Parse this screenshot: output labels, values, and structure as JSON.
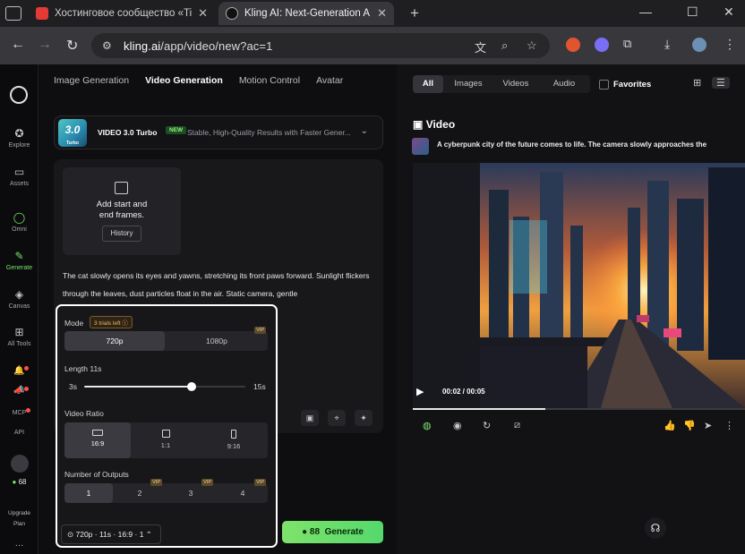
{
  "browser": {
    "tabs": [
      {
        "title": "Хостинговое сообщество «Tim",
        "close": "✕"
      },
      {
        "title": "Kling AI: Next-Generation AI Cr",
        "close": "✕"
      }
    ],
    "new_tab": "+",
    "window_controls": {
      "minimize": "—",
      "maximize": "☐",
      "close": "✕"
    },
    "url_domain": "kling.ai",
    "url_path": "/app/video/new?ac=1",
    "nav": {
      "back": "←",
      "forward": "→",
      "reload": "↻"
    }
  },
  "rail": {
    "items": [
      {
        "label": "Explore",
        "icon": "✪"
      },
      {
        "label": "Assets",
        "icon": "▭"
      },
      {
        "label": "Omni",
        "icon": "◯"
      },
      {
        "label": "Generate",
        "icon": "✎"
      },
      {
        "label": "Canvas",
        "icon": "◈"
      },
      {
        "label": "All Tools",
        "icon": "⊞"
      },
      {
        "label": "",
        "icon": "🔔"
      },
      {
        "label": "",
        "icon": "📣"
      },
      {
        "label": "MCP",
        "icon": ""
      },
      {
        "label": "API",
        "icon": ""
      }
    ],
    "credits": "68",
    "upgrade": "Upgrade",
    "plan": "Plan",
    "more": "…"
  },
  "topnav": [
    "Image Generation",
    "Video Generation",
    "Motion Control",
    "Avatar"
  ],
  "model": {
    "thumb_text": "3.0",
    "thumb_sub": "Turbo",
    "name": "VIDEO 3.0 Turbo",
    "badge": "NEW",
    "description": "Stable, High-Quality Results with Faster Gener..."
  },
  "frames": {
    "line1": "Add start and",
    "line2": "end frames.",
    "history": "History"
  },
  "prompt": "The cat slowly opens its eyes and yawns, stretching its front paws forward. Sunlight flickers through the leaves, dust particles float in the air. Static camera, gentle",
  "settings": {
    "mode_label": "Mode",
    "trials": "3 trials left ⓘ",
    "modes": [
      {
        "label": "720p",
        "selected": true,
        "vip": false
      },
      {
        "label": "1080p",
        "selected": false,
        "vip": true
      }
    ],
    "vip_tag": "VIP",
    "length_label": "Length 11s",
    "length_min": "3s",
    "length_max": "15s",
    "length_value": 11,
    "length_range": [
      3,
      15
    ],
    "ratio_label": "Video Ratio",
    "ratios": [
      {
        "label": "16:9",
        "selected": true
      },
      {
        "label": "1:1",
        "selected": false
      },
      {
        "label": "9:16",
        "selected": false
      }
    ],
    "outputs_label": "Number of Outputs",
    "outputs": [
      {
        "label": "1",
        "selected": true,
        "vip": false
      },
      {
        "label": "2",
        "selected": false,
        "vip": true
      },
      {
        "label": "3",
        "selected": false,
        "vip": true
      },
      {
        "label": "4",
        "selected": false,
        "vip": true
      }
    ],
    "summary": "720p · 11s · 16:9 · 1"
  },
  "generate": {
    "credits": "88",
    "label": "Generate"
  },
  "right": {
    "filters": [
      {
        "label": "All",
        "selected": true
      },
      {
        "label": "Images"
      },
      {
        "label": "Videos"
      },
      {
        "label": "Audio"
      }
    ],
    "favorites": "Favorites",
    "section_title": "Video",
    "video_prompt": "A cyberpunk city of the future comes to life. The camera slowly approaches the",
    "time": "00:02 / 00:05",
    "progress": 0.4
  },
  "colors": {
    "accent": "#79e26a",
    "generate": "#6fdd6b",
    "highlight_border": "#ffffff"
  }
}
